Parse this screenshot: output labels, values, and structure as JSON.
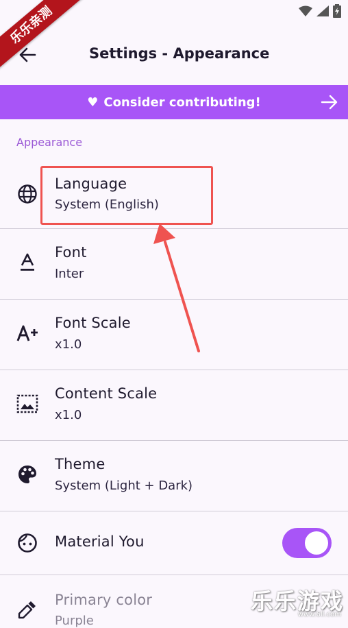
{
  "watermark": {
    "ribbon_text": "乐乐亲测",
    "corner_text": "乐乐游戏",
    "corner_url": "www.6ll.com"
  },
  "status_bar": {
    "icons": [
      "wifi-icon",
      "signal-icon",
      "battery-charging-icon"
    ]
  },
  "app_bar": {
    "back_icon": "arrow-back-icon",
    "title": "Settings - Appearance"
  },
  "banner": {
    "heart": "♥",
    "text": "Consider contributing!",
    "arrow_icon": "arrow-forward-icon",
    "color": "#a855f7"
  },
  "section": {
    "label": "Appearance"
  },
  "settings": {
    "language": {
      "icon": "globe-icon",
      "title": "Language",
      "value": "System (English)"
    },
    "font": {
      "icon": "font-icon",
      "title": "Font",
      "value": "Inter"
    },
    "font_scale": {
      "icon": "font-scale-icon",
      "title": "Font Scale",
      "value": "x1.0"
    },
    "content_scale": {
      "icon": "content-scale-icon",
      "title": "Content Scale",
      "value": "x1.0"
    },
    "theme": {
      "icon": "palette-icon",
      "title": "Theme",
      "value": "System (Light + Dark)"
    },
    "material_you": {
      "icon": "face-icon",
      "title": "Material You",
      "enabled": true
    },
    "primary_color": {
      "icon": "color-picker-icon",
      "title": "Primary color",
      "value": "Purple",
      "disabled": true
    }
  },
  "annotation": {
    "highlight_color": "#ef5350"
  }
}
